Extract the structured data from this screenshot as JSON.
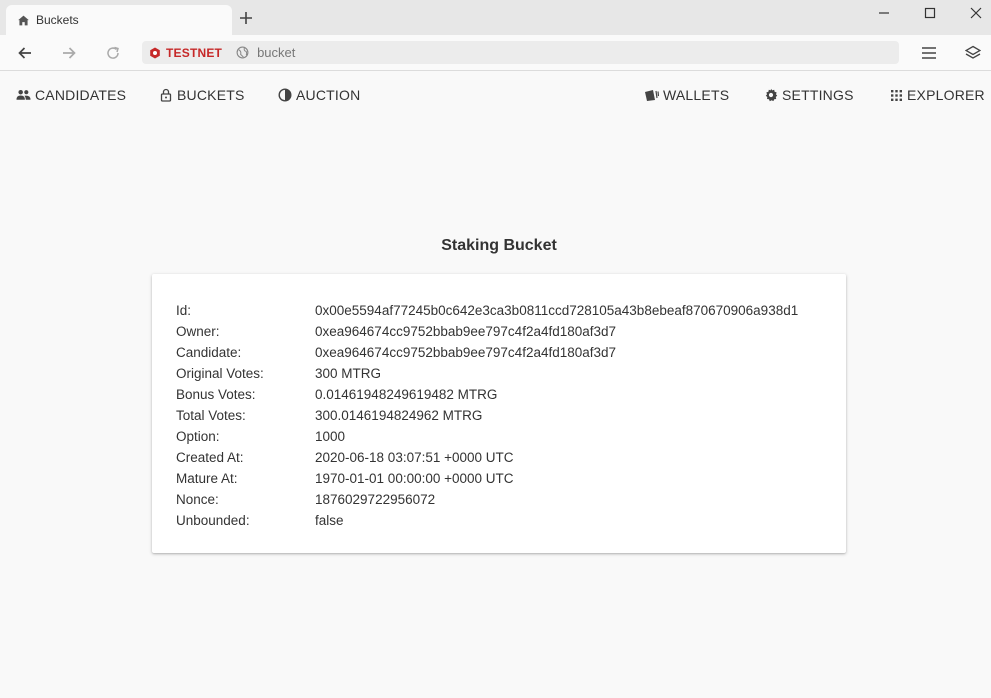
{
  "browser": {
    "tab_title": "Buckets",
    "network_label": "TESTNET",
    "url": "bucket"
  },
  "nav": {
    "candidates": "CANDIDATES",
    "buckets": "BUCKETS",
    "auction": "AUCTION",
    "wallets": "WALLETS",
    "settings": "SETTINGS",
    "explorer": "EXPLORER"
  },
  "page": {
    "title": "Staking Bucket"
  },
  "bucket": {
    "rows": [
      {
        "label": "Id:",
        "value": "0x00e5594af77245b0c642e3ca3b0811ccd728105a43b8ebeaf870670906a938d1"
      },
      {
        "label": "Owner:",
        "value": "0xea964674cc9752bbab9ee797c4f2a4fd180af3d7"
      },
      {
        "label": "Candidate:",
        "value": "0xea964674cc9752bbab9ee797c4f2a4fd180af3d7"
      },
      {
        "label": "Original Votes:",
        "value": "300 MTRG"
      },
      {
        "label": "Bonus Votes:",
        "value": "0.01461948249619482 MTRG"
      },
      {
        "label": "Total Votes:",
        "value": "300.0146194824962 MTRG"
      },
      {
        "label": "Option:",
        "value": "1000"
      },
      {
        "label": "Created At:",
        "value": "2020-06-18 03:07:51 +0000 UTC"
      },
      {
        "label": "Mature At:",
        "value": "1970-01-01 00:00:00 +0000 UTC"
      },
      {
        "label": "Nonce:",
        "value": "1876029722956072"
      },
      {
        "label": "Unbounded:",
        "value": "false"
      }
    ]
  },
  "colors": {
    "network_accent": "#c62828",
    "page_background": "#f9f9f9",
    "card_background": "#ffffff"
  }
}
